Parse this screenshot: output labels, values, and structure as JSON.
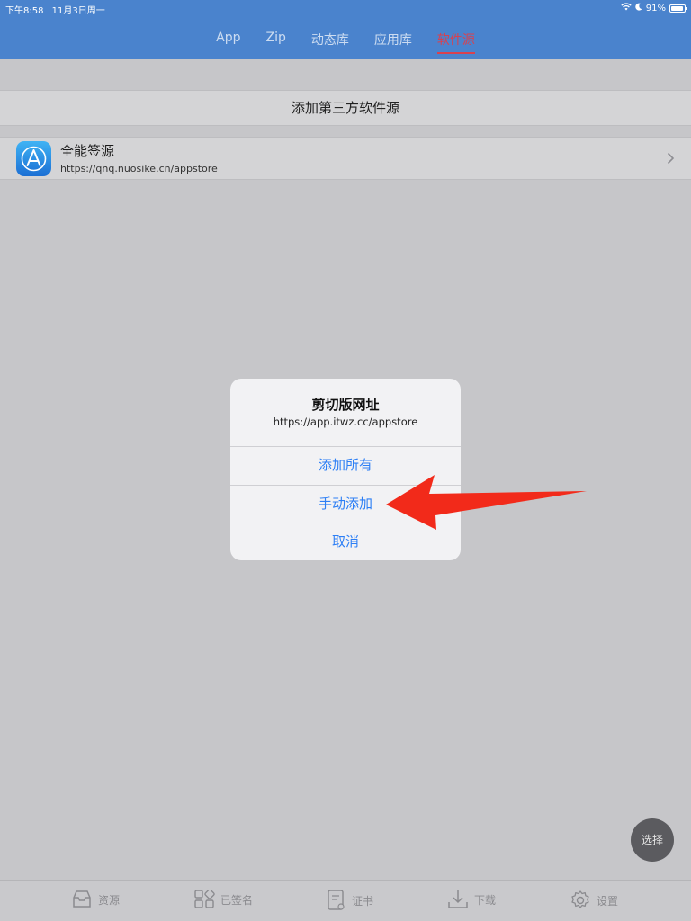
{
  "status_bar": {
    "time": "下午8:58",
    "date": "11月3日周一",
    "battery_text": "91%",
    "battery_level": 0.91
  },
  "top_tabs": [
    {
      "label": "App",
      "active": false
    },
    {
      "label": "Zip",
      "active": false
    },
    {
      "label": "动态库",
      "active": false
    },
    {
      "label": "应用库",
      "active": false
    },
    {
      "label": "软件源",
      "active": true
    }
  ],
  "add_source": {
    "label": "添加第三方软件源"
  },
  "sources": [
    {
      "title": "全能签源",
      "url": "https://qnq.nuosike.cn/appstore",
      "icon": "app-store-icon"
    }
  ],
  "alert": {
    "title": "剪切版网址",
    "message": "https://app.itwz.cc/appstore",
    "buttons": [
      "添加所有",
      "手动添加",
      "取消"
    ]
  },
  "fab": {
    "label": "选择"
  },
  "bottom_tabs": [
    {
      "label": "资源",
      "icon": "inbox-icon"
    },
    {
      "label": "已签名",
      "icon": "grid-icon"
    },
    {
      "label": "证书",
      "icon": "certificate-icon"
    },
    {
      "label": "下载",
      "icon": "download-icon"
    },
    {
      "label": "设置",
      "icon": "gear-icon"
    }
  ],
  "colors": {
    "header": "#4a83cd",
    "active_tab": "#d9414f",
    "alert_button": "#2d7ff5",
    "annotation_arrow": "#f22a1a"
  }
}
